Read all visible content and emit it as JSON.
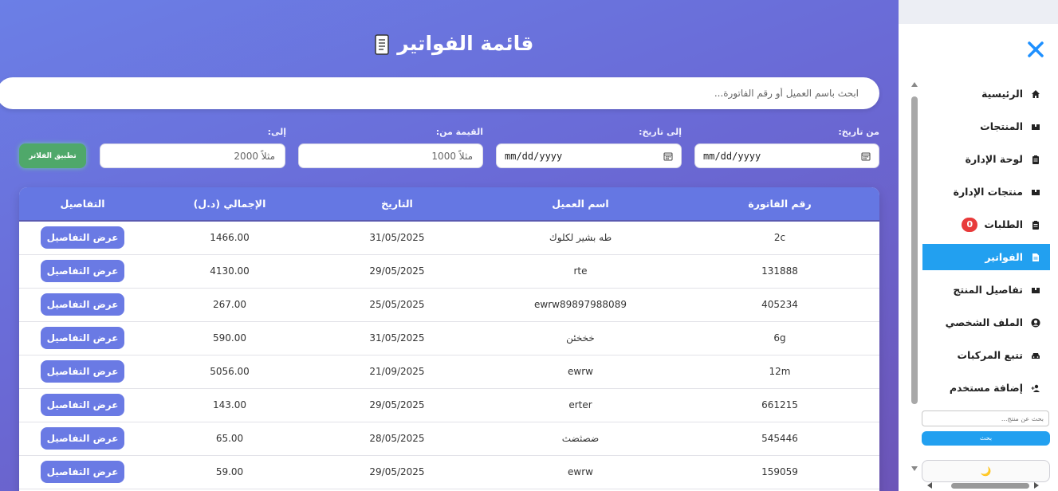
{
  "title": "قائمة الفواتير",
  "search": {
    "placeholder": "ابحث باسم العميل أو رقم الفاتورة..."
  },
  "filters": {
    "from_date_label": "من تاريخ:",
    "to_date_label": "إلى تاريخ:",
    "min_value_label": "القيمة من:",
    "max_value_label": "إلى:",
    "from_date_value": "mm/dd/yyyy",
    "to_date_value": "mm/dd/yyyy",
    "min_value_placeholder": "مثلاً 1000",
    "max_value_placeholder": "مثلاً 2000",
    "apply_label": "تطبيق الفلاتر"
  },
  "table": {
    "headers": [
      "رقم الفاتورة",
      "اسم العميل",
      "التاريخ",
      "الإجمالي (د.ل)",
      "التفاصيل"
    ],
    "details_label": "عرض التفاصيل",
    "rows": [
      {
        "invoice": "2c",
        "customer": "طه بشير لكلوك",
        "date": "31/05/2025",
        "total": "1466.00"
      },
      {
        "invoice": "131888",
        "customer": "rte",
        "date": "29/05/2025",
        "total": "4130.00"
      },
      {
        "invoice": "405234",
        "customer": "ewrw89897988089",
        "date": "25/05/2025",
        "total": "267.00"
      },
      {
        "invoice": "6g",
        "customer": "خخخئن",
        "date": "31/05/2025",
        "total": "590.00"
      },
      {
        "invoice": "12m",
        "customer": "ewrw",
        "date": "21/09/2025",
        "total": "5056.00"
      },
      {
        "invoice": "661215",
        "customer": "erter",
        "date": "29/05/2025",
        "total": "143.00"
      },
      {
        "invoice": "545446",
        "customer": "ضصثضث",
        "date": "28/05/2025",
        "total": "65.00"
      },
      {
        "invoice": "159059",
        "customer": "ewrw",
        "date": "29/05/2025",
        "total": "59.00"
      }
    ]
  },
  "sidebar": {
    "items": [
      {
        "label": "الرئيسية",
        "icon": "home-icon"
      },
      {
        "label": "المنتجات",
        "icon": "box-icon"
      },
      {
        "label": "لوحة الإدارة",
        "icon": "clipboard-icon"
      },
      {
        "label": "منتجات الإدارة",
        "icon": "box-icon"
      },
      {
        "label": "الطلبات",
        "icon": "clipboard-icon",
        "badge": "0"
      },
      {
        "label": "الفواتير",
        "icon": "file-icon",
        "active": true
      },
      {
        "label": "تفاصيل المنتج",
        "icon": "box-icon"
      },
      {
        "label": "الملف الشخصي",
        "icon": "user-circle-icon"
      },
      {
        "label": "تتبع المركبات",
        "icon": "car-icon"
      },
      {
        "label": "إضافة مستخدم",
        "icon": "user-plus-icon"
      }
    ],
    "search_placeholder": "بحث عن منتج...",
    "search_button": "بحث",
    "theme_icon": "🌙"
  },
  "colors": {
    "accent": "#6a7ae4",
    "sidebar_active": "#22a0f0",
    "apply": "#4fa86a",
    "badge": "#e83a3a"
  }
}
